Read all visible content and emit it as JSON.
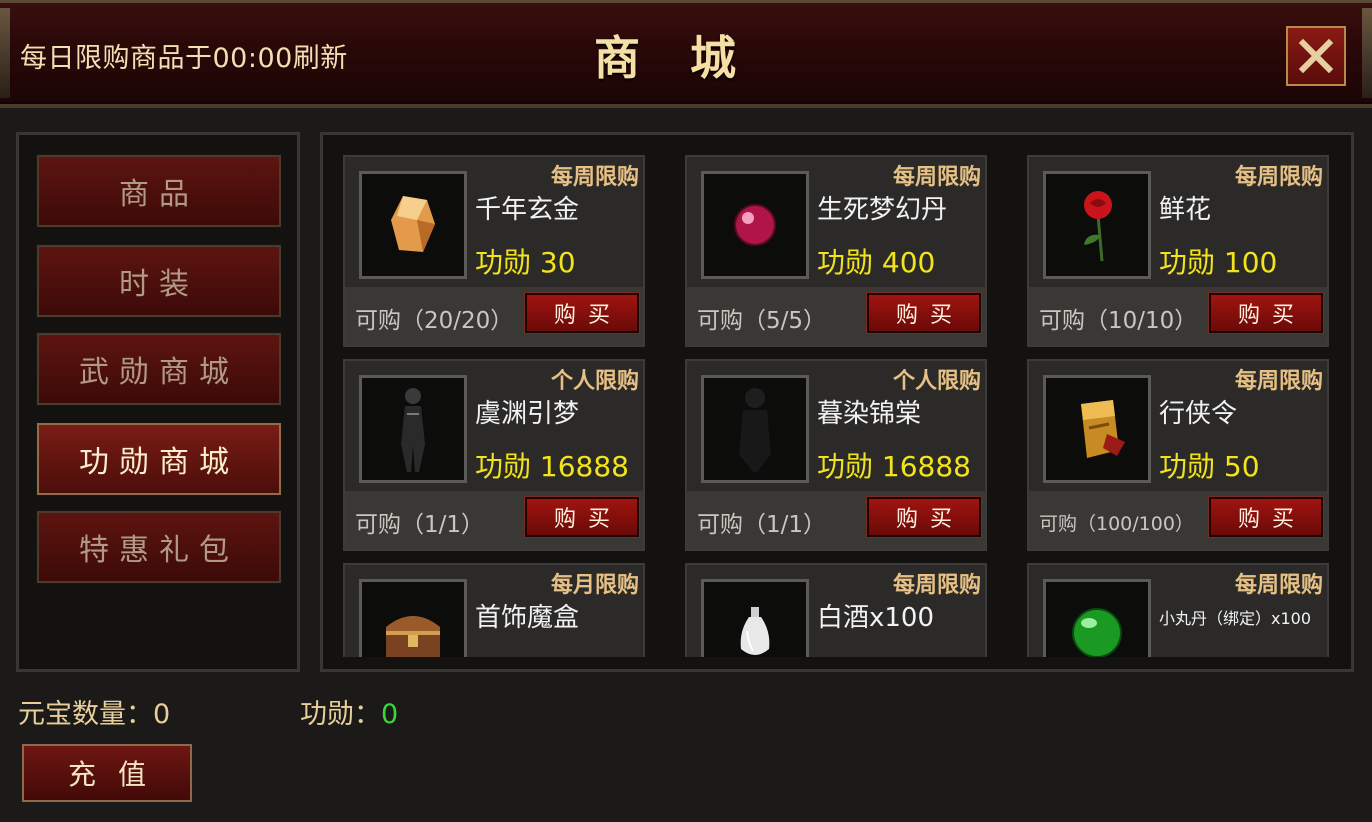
{
  "header": {
    "notice": "每日限购商品于00:00刷新",
    "title": "商城"
  },
  "sidebar": {
    "items": [
      {
        "label": "商品",
        "active": false
      },
      {
        "label": "时装",
        "active": false
      },
      {
        "label": "武勋商城",
        "active": false
      },
      {
        "label": "功勋商城",
        "active": true
      },
      {
        "label": "特惠礼包",
        "active": false
      }
    ]
  },
  "items": [
    {
      "limit": "每周限购",
      "name": "千年玄金",
      "price": "功勋 30",
      "stock": "可购（20/20）",
      "buy": "购买",
      "icon": "amber-crystal-icon"
    },
    {
      "limit": "每周限购",
      "name": "生死梦幻丹",
      "price": "功勋 400",
      "stock": "可购（5/5）",
      "buy": "购买",
      "icon": "red-pill-icon"
    },
    {
      "limit": "每周限购",
      "name": "鲜花",
      "price": "功勋 100",
      "stock": "可购（10/10）",
      "buy": "购买",
      "icon": "rose-icon"
    },
    {
      "limit": "个人限购",
      "name": "虞渊引梦",
      "price": "功勋 16888",
      "stock": "可购（1/1）",
      "buy": "购买",
      "icon": "costume-icon"
    },
    {
      "limit": "个人限购",
      "name": "暮染锦棠",
      "price": "功勋 16888",
      "stock": "可购（1/1）",
      "buy": "购买",
      "icon": "costume-dark-icon"
    },
    {
      "limit": "每周限购",
      "name": "行侠令",
      "price": "功勋 50",
      "stock": "可购（100/100）",
      "buy": "购买",
      "icon": "golden-token-icon"
    },
    {
      "limit": "每月限购",
      "name": "首饰魔盒",
      "price": "",
      "stock": "",
      "buy": "",
      "icon": "treasure-chest-icon"
    },
    {
      "limit": "每周限购",
      "name": "白酒x100",
      "price": "",
      "stock": "",
      "buy": "",
      "icon": "wine-bottle-icon"
    },
    {
      "limit": "每周限购",
      "name": "小丸丹（绑定）x100",
      "price": "",
      "stock": "",
      "buy": "",
      "icon": "green-orb-icon"
    }
  ],
  "footer": {
    "yuanbao_label": "元宝数量：",
    "yuanbao_value": "0",
    "merit_label": "功勋：",
    "merit_value": "0",
    "recharge_label": "充值"
  },
  "colors": {
    "price": "#f2e41c",
    "limit": "#e6c084",
    "merit_value": "#37d83a",
    "buy_button": "#a01410"
  }
}
